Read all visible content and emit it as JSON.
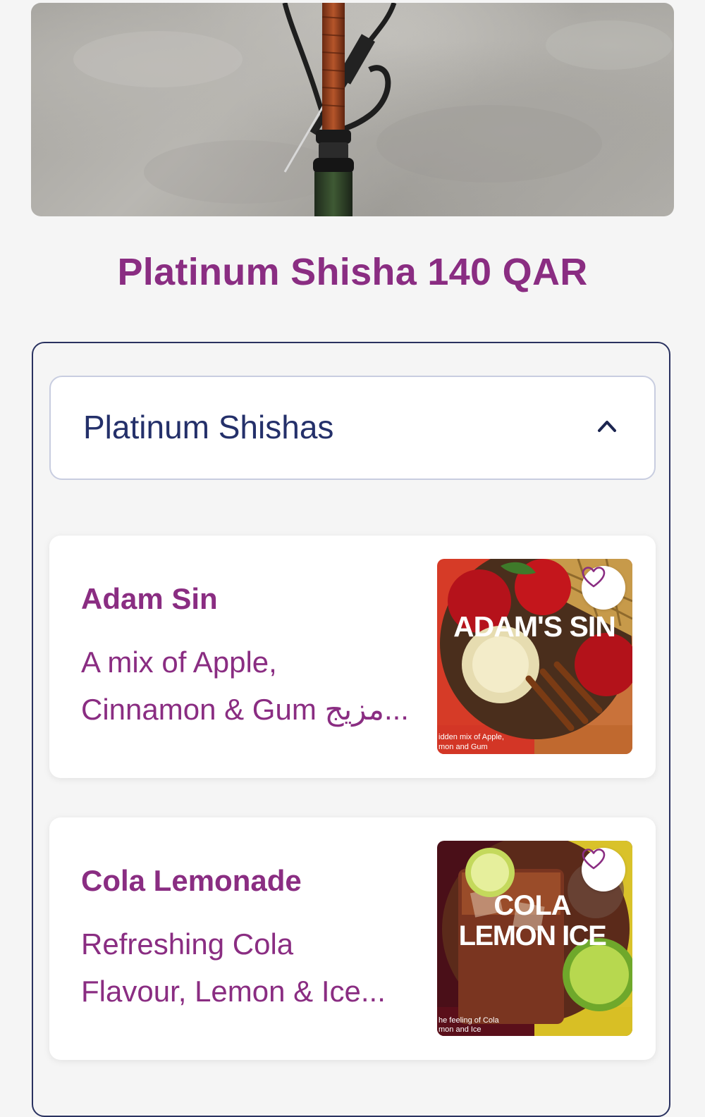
{
  "title": "Platinum Shisha 140 QAR",
  "category": {
    "label": "Platinum Shishas",
    "icon": "chevron-up-icon",
    "expanded": true
  },
  "products": [
    {
      "name": "Adam Sin",
      "description_line1": "A mix of Apple,",
      "description_line2": "Cinnamon & Gum مزيج...",
      "image_title": "ADAM'S SIN",
      "image_caption_line1": "idden mix of Apple,",
      "image_caption_line2": "mon and Gum",
      "favorite_icon": "heart-icon"
    },
    {
      "name": "Cola Lemonade",
      "description_line1": "Refreshing Cola",
      "description_line2": "Flavour, Lemon & Ice...",
      "image_title_line1": "COLA",
      "image_title_line2": "LEMON ICE",
      "image_caption_line1": "he feeling of Cola",
      "image_caption_line2": "mon and Ice",
      "favorite_icon": "heart-icon"
    }
  ],
  "colors": {
    "accent": "#8a2d82",
    "navy": "#24306a",
    "panel_border": "#2a3260",
    "background": "#f5f5f5"
  }
}
